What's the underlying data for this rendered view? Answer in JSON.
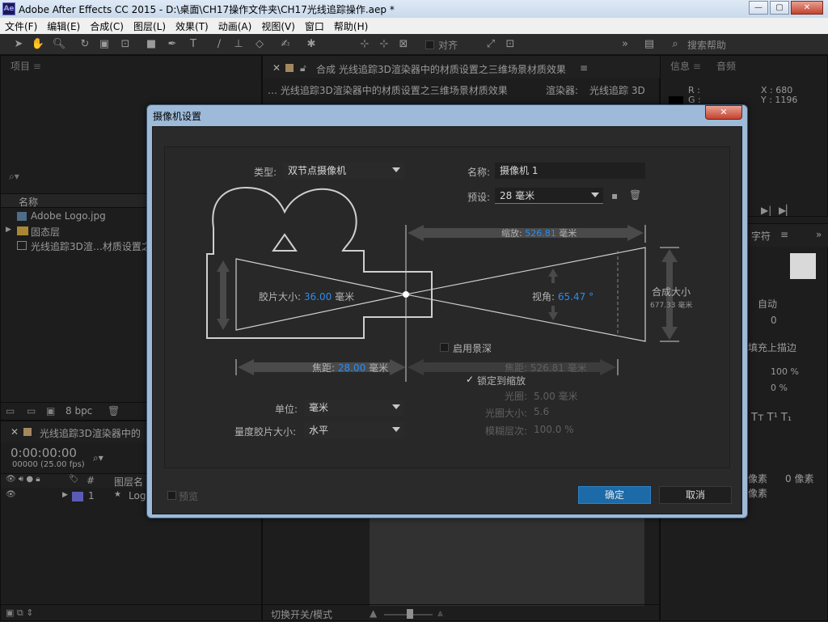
{
  "window": {
    "title": "Adobe After Effects CC 2015 - D:\\桌面\\CH17操作文件夹\\CH17光线追踪操作.aep *",
    "app_icon": "Ae",
    "minimize": "—",
    "maximize": "▢",
    "close": "✕"
  },
  "menu": [
    "文件(F)",
    "编辑(E)",
    "合成(C)",
    "图层(L)",
    "效果(T)",
    "动画(A)",
    "视图(V)",
    "窗口",
    "帮助(H)"
  ],
  "toolbar": {
    "align_label": "对齐",
    "search_placeholder": "搜索帮助"
  },
  "project": {
    "title": "项目",
    "col_name": "名称",
    "items": [
      "Adobe Logo.jpg",
      "固态层",
      "光线追踪3D渲…材质设置之"
    ],
    "bpc": "8 bpc"
  },
  "comp": {
    "tab_label": "合成",
    "tab_title": "光线追踪3D渲染器中的材质设置之三维场景材质效果",
    "breadcrumb": "光线追踪3D渲染器中的材质设置之三维场景材质效果",
    "renderer_label": "渲染器:",
    "renderer_value": "光线追踪 3D"
  },
  "info": {
    "tab": "信息",
    "audio_tab": "音频",
    "r": "R :",
    "g": "G :",
    "x": "X : 680",
    "y": "Y : 1196"
  },
  "character": {
    "tab": "字符",
    "auto": "自动",
    "zero": "0",
    "stroke": "填充上描边",
    "pct1": "100 %",
    "pct2": "0 %",
    "px1": "像素",
    "px2": "0 像素",
    "px3": "像素"
  },
  "timeline": {
    "tab_title": "光线追踪3D渲染器中的",
    "timecode": "0:00:00:00",
    "fps": "00000 (25.00 fps)",
    "col_layer": "图层名",
    "col_num": "#",
    "row_num": "1",
    "row_name": "Log",
    "toggle": "切换开关/模式"
  },
  "dialog": {
    "title": "摄像机设置",
    "type_label": "类型:",
    "type_value": "双节点摄像机",
    "name_label": "名称:",
    "name_value": "摄像机 1",
    "preset_label": "预设:",
    "preset_value": "28 毫米",
    "zoom_label": "缩放:",
    "zoom_value": "526.81",
    "zoom_unit": "毫米",
    "film_label": "胶片大小:",
    "film_value": "36.00",
    "film_unit": "毫米",
    "angle_label": "视角:",
    "angle_value": "65.47",
    "angle_unit": "°",
    "comp_size_label": "合成大小",
    "comp_size_value": "677.33 毫米",
    "dof_label": "启用景深",
    "focal_label": "焦距:",
    "focal_value": "28.00",
    "focal_unit": "毫米",
    "focus_label": "焦距:",
    "focus_value": "526.81",
    "focus_unit": "毫米",
    "lock_label": "锁定到缩放",
    "aperture_label": "光圈:",
    "aperture_value": "5.00 毫米",
    "fstop_label": "光圈大小:",
    "fstop_value": "5.6",
    "blur_label": "模糊层次:",
    "blur_value": "100.0 %",
    "units_label": "单位:",
    "units_value": "毫米",
    "measure_label": "量度胶片大小:",
    "measure_value": "水平",
    "preview_label": "预览",
    "ok": "确定",
    "cancel": "取消"
  },
  "colors": {
    "accent": "#2d8ceb",
    "ok_button": "#1c6aa8"
  }
}
